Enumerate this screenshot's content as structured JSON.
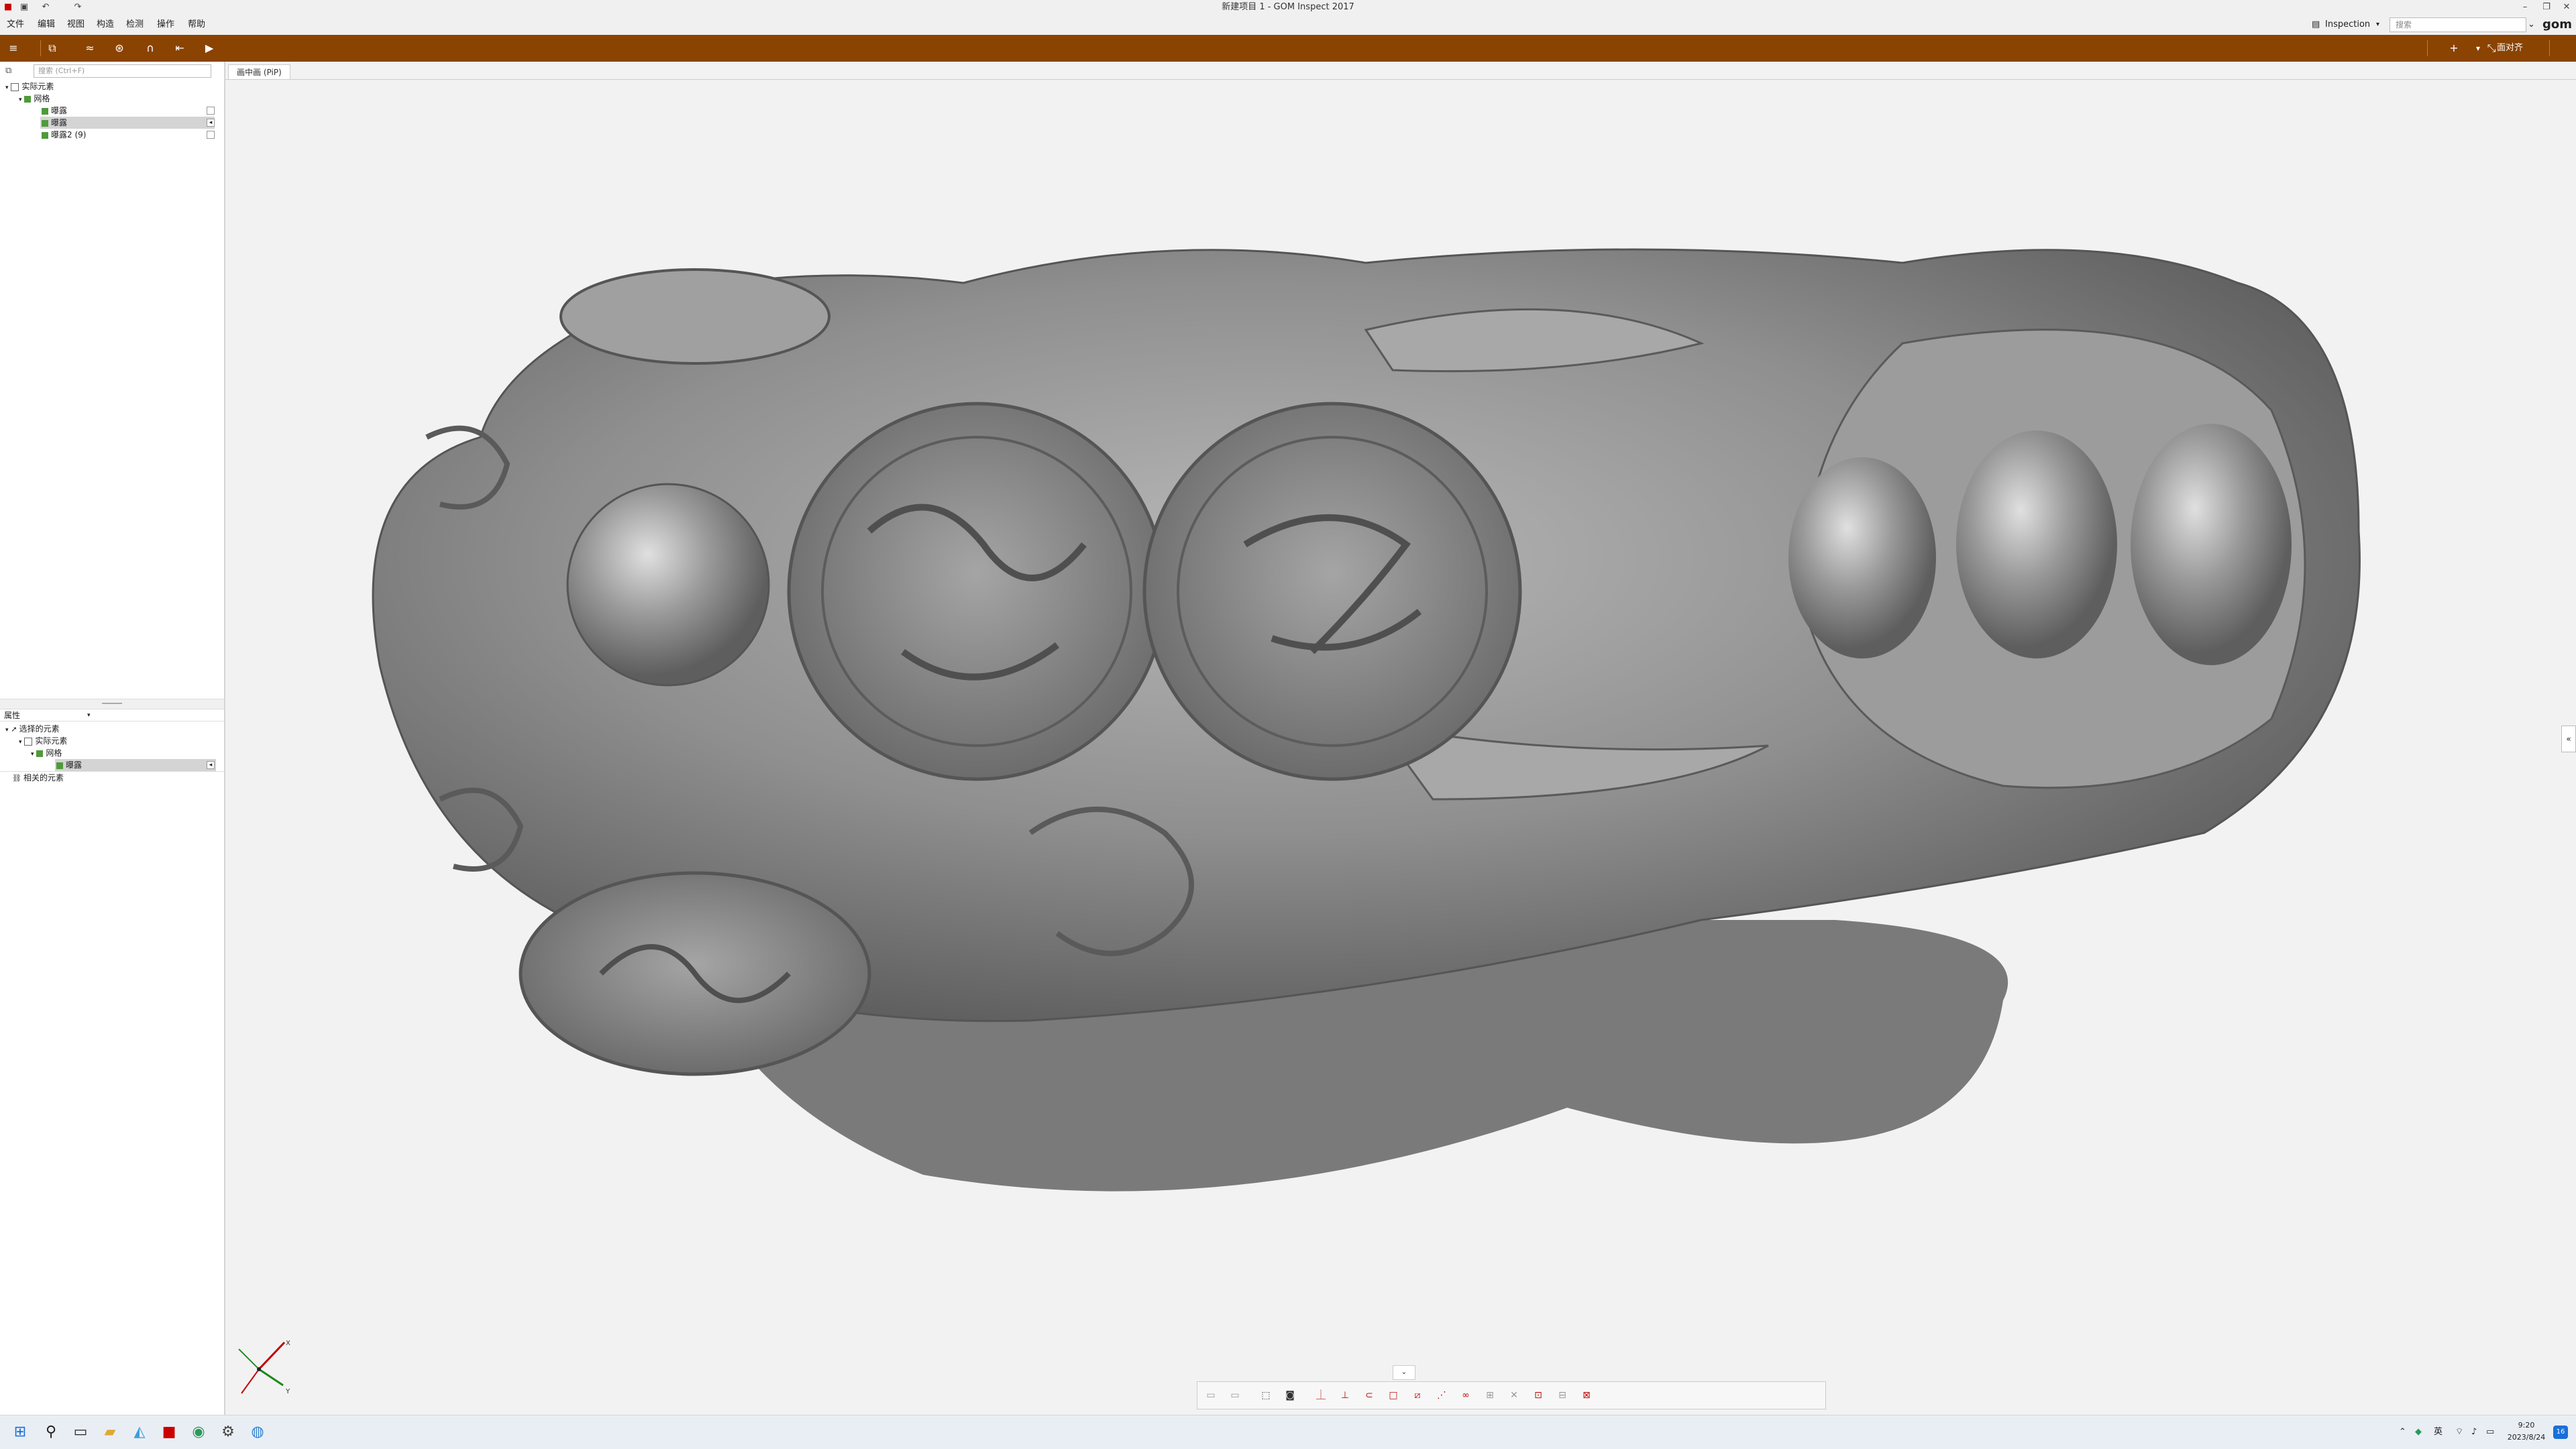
{
  "window": {
    "title": "新建项目 1 - GOM Inspect 2017"
  },
  "menubar": {
    "items": [
      "文件",
      "编辑",
      "视图",
      "构造",
      "检测",
      "操作",
      "帮助"
    ],
    "workspace_label": "Inspection",
    "search_placeholder": "搜索",
    "brand": "gom"
  },
  "toolbar": {
    "right_label": "面对齐"
  },
  "explorer": {
    "filter_placeholder": "搜索 (Ctrl+F)",
    "tree": [
      {
        "label": "实际元素",
        "level": 0
      },
      {
        "label": "网格",
        "level": 1
      },
      {
        "label": "曝露",
        "level": 2
      },
      {
        "label": "曝露",
        "level": 2,
        "selected": true
      },
      {
        "label": "曝露2 (9)",
        "level": 2
      }
    ]
  },
  "properties": {
    "header_label": "属性",
    "tree": [
      {
        "label": "选择的元素",
        "level": 0
      },
      {
        "label": "实际元素",
        "level": 1
      },
      {
        "label": "网格",
        "level": 2
      },
      {
        "label": "曝露",
        "level": 3,
        "selected": true
      },
      {
        "label": "相关的元素",
        "level": 0
      }
    ]
  },
  "viewport": {
    "tab_label": "画中画 (PiP)",
    "collapse_label": "«",
    "axis": {
      "x": "X",
      "y": "Y"
    }
  },
  "taskbar": {
    "lang": "英",
    "time": "9:20",
    "date": "2023/8/24",
    "badge": "16"
  },
  "colors": {
    "accent_toolbar": "#8a4300",
    "selection": "#d4d4d4",
    "tree_icon_green": "#4f9a3a"
  }
}
